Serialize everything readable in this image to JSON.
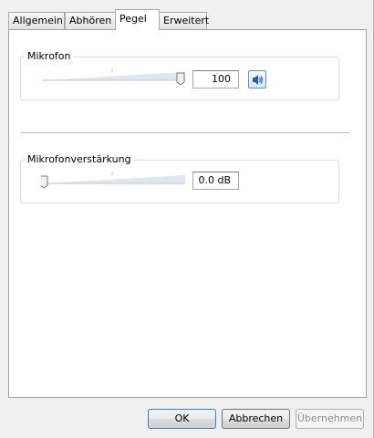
{
  "tabs": [
    {
      "label": "Allgemein",
      "active": false
    },
    {
      "label": "Abhören",
      "active": false
    },
    {
      "label": "Pegel",
      "active": true
    },
    {
      "label": "Erweitert",
      "active": false
    }
  ],
  "microphone": {
    "label": "Mikrofon",
    "value_text": "100",
    "level": 100,
    "speaker_icon": "speaker-icon"
  },
  "gain": {
    "label": "Mikrofonverstärkung",
    "value_text": "0.0 dB",
    "level": 0
  },
  "buttons": {
    "ok": "OK",
    "cancel": "Abbrechen",
    "apply": "Übernehmen"
  },
  "colors": {
    "panel_bg": "#ffffff",
    "dialog_bg": "#f0f0f0",
    "accent_blue": "#1c5fb3"
  }
}
